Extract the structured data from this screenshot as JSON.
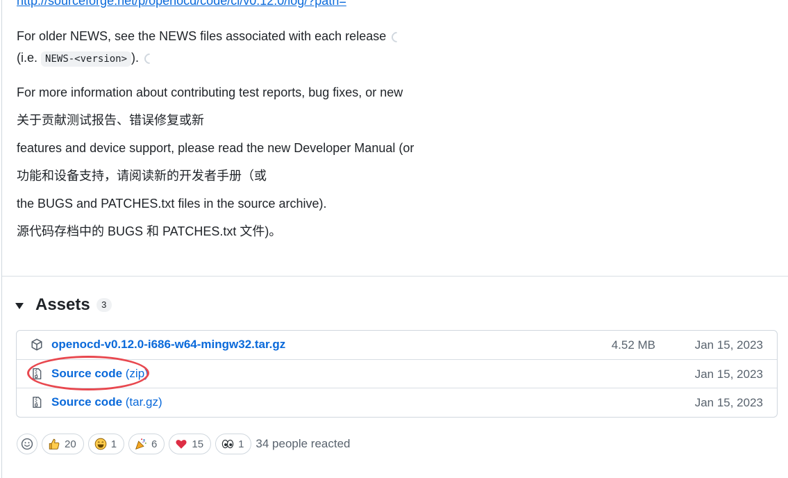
{
  "release": {
    "top_link": "http://sourceforge.net/p/openocd/code/ci/v0.12.0/log/?path=",
    "news_line1": "For older NEWS, see the NEWS files associated with each release",
    "news_line2_prefix": "(i.e.",
    "news_code": "NEWS-<version>",
    "news_line2_suffix": ").",
    "info_en_1": "For more information about contributing test reports, bug fixes, or new",
    "info_zh_1": "关于贡献测试报告、错误修复或新",
    "info_en_2": "features and device support, please read the new Developer Manual (or",
    "info_zh_2": "功能和设备支持，请阅读新的开发者手册（或",
    "info_en_3": "the BUGS and PATCHES.txt files in the source archive).",
    "info_zh_3": "源代码存档中的 BUGS 和 PATCHES.txt 文件)。"
  },
  "assets": {
    "title": "Assets",
    "count": "3",
    "items": [
      {
        "name": "openocd-v0.12.0-i686-w64-mingw32.tar.gz",
        "suffix": "",
        "size": "4.52 MB",
        "date": "Jan 15, 2023",
        "icon": "package-icon"
      },
      {
        "name": "Source code",
        "suffix": " (zip)",
        "size": "",
        "date": "Jan 15, 2023",
        "icon": "file-zip-icon"
      },
      {
        "name": "Source code",
        "suffix": " (tar.gz)",
        "size": "",
        "date": "Jan 15, 2023",
        "icon": "file-zip-icon"
      }
    ]
  },
  "reactions": {
    "items": [
      {
        "emoji": "thumbs-up-icon",
        "count": "20"
      },
      {
        "emoji": "laugh-icon",
        "count": "1"
      },
      {
        "emoji": "hooray-icon",
        "count": "6"
      },
      {
        "emoji": "heart-icon",
        "count": "15"
      },
      {
        "emoji": "eyes-icon",
        "count": "1"
      }
    ],
    "summary": "34 people reacted"
  },
  "colors": {
    "link": "#0969da",
    "annotation": "#e8484f",
    "muted": "#59636e"
  }
}
